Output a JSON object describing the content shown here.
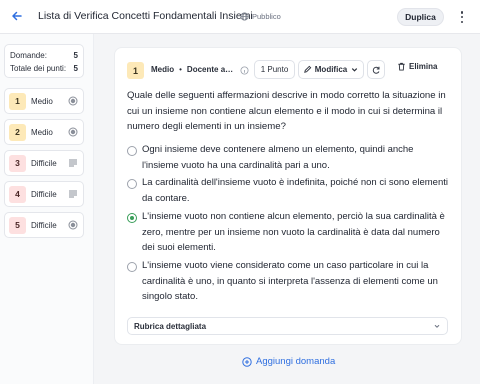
{
  "header": {
    "title": "Lista di Verifica Concetti Fondamentali Insiemi",
    "visibility": "Pubblico",
    "duplicate_label": "Duplica"
  },
  "summary": {
    "questions_label": "Domande:",
    "questions_value": "5",
    "points_label": "Totale dei punti:",
    "points_value": "5"
  },
  "sidebar": {
    "items": [
      {
        "num": "1",
        "difficulty": "Medio",
        "type_icon": "radio-icon"
      },
      {
        "num": "2",
        "difficulty": "Medio",
        "type_icon": "radio-icon"
      },
      {
        "num": "3",
        "difficulty": "Difficile",
        "type_icon": "text-lines-icon"
      },
      {
        "num": "4",
        "difficulty": "Difficile",
        "type_icon": "text-lines-icon"
      },
      {
        "num": "5",
        "difficulty": "Difficile",
        "type_icon": "radio-icon"
      }
    ]
  },
  "question": {
    "number": "1",
    "difficulty": "Medio",
    "separator": "•",
    "creator": "Docente anonimo",
    "points": "1 Punto",
    "modify_label": "Modifica",
    "delete_label": "Elimina",
    "text": "Quale delle seguenti affermazioni descrive in modo corretto la situazione in cui un insieme non contiene alcun elemento e il modo in cui si determina il numero degli elementi in un insieme?",
    "options": [
      {
        "text": "Ogni insieme deve contenere almeno un elemento, quindi anche l'insieme vuoto ha una cardinalità pari a uno.",
        "selected": false
      },
      {
        "text": "La cardinalità dell'insieme vuoto è indefinita, poiché non ci sono elementi da contare.",
        "selected": false
      },
      {
        "text": "L'insieme vuoto non contiene alcun elemento, perciò la sua cardinalità è zero, mentre per un insieme non vuoto la cardinalità è data dal numero dei suoi elementi.",
        "selected": true
      },
      {
        "text": "L'insieme vuoto viene considerato come un caso particolare in cui la cardinalità è uno, in quanto si interpreta l'assenza di elementi come un singolo stato.",
        "selected": false
      }
    ],
    "rubric_label": "Rubrica dettagliata"
  },
  "add_question_label": "Aggiungi domanda",
  "colors": {
    "accent": "#2f6fe0",
    "correct": "#3a9e5a",
    "medium_badge": "#fde9b8",
    "hard_badge": "#fde0e0"
  }
}
